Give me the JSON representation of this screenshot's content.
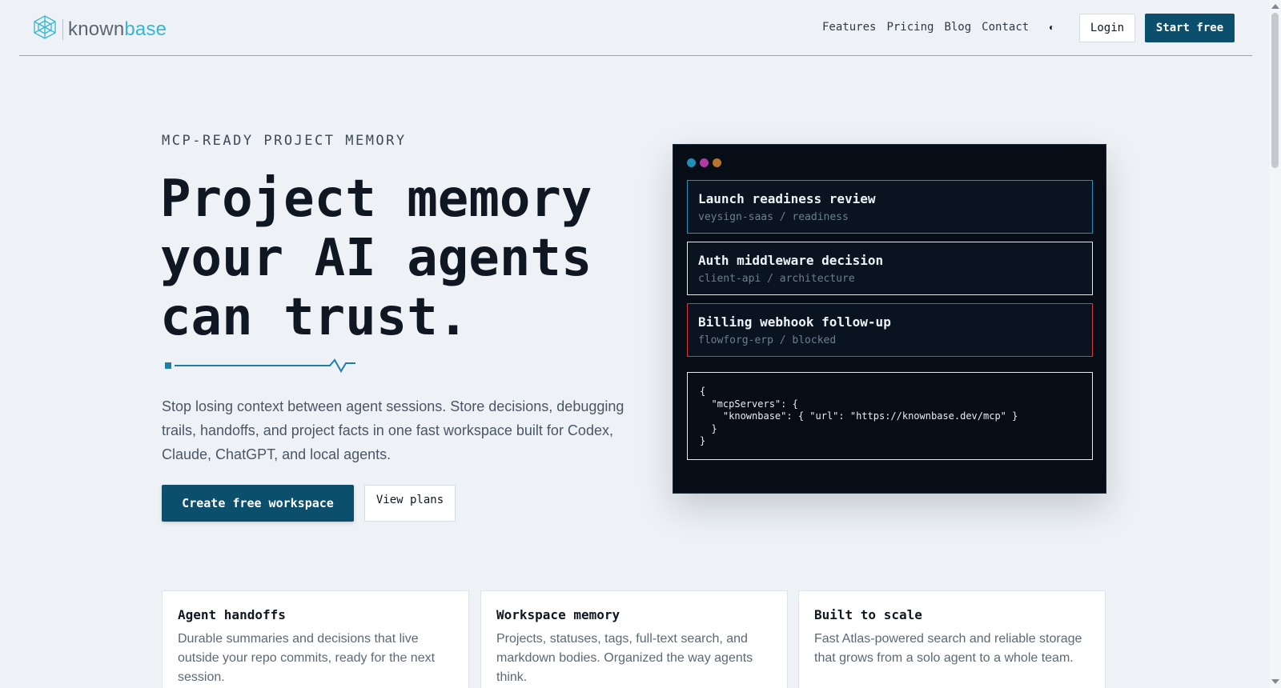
{
  "brand": {
    "name_part1": "known",
    "name_part2": "base",
    "accent": "#35b6d3"
  },
  "nav": {
    "items": [
      "Features",
      "Pricing",
      "Blog",
      "Contact"
    ],
    "theme_toggle_glyph": "◐",
    "login_label": "Login",
    "start_label": "Start free"
  },
  "hero": {
    "eyebrow": "MCP-READY PROJECT MEMORY",
    "headline_lines": [
      "Project memory",
      "your AI agents",
      "can trust."
    ],
    "lead": "Stop losing context between agent sessions. Store decisions, debugging trails, handoffs, and project facts in one fast workspace built for Codex, Claude, ChatGPT, and local agents.",
    "primary_cta": "Create free workspace",
    "secondary_cta": "View plans"
  },
  "panel": {
    "dots": [
      "#1f8fb5",
      "#b23aa3",
      "#b8742a"
    ],
    "cards": [
      {
        "title": "Launch readiness review",
        "subtitle": "veysign-saas / readiness",
        "border": "#2b8fb3"
      },
      {
        "title": "Auth middleware decision",
        "subtitle": "client-api / architecture",
        "border": "#e6ebf0"
      },
      {
        "title": "Billing webhook follow-up",
        "subtitle": "flowforg-erp / blocked",
        "border": "#d8363c"
      }
    ],
    "code": "{\n  \"mcpServers\": {\n    \"knownbase\": { \"url\": \"https://knownbase.dev/mcp\" }\n  }\n}"
  },
  "features": [
    {
      "title": "Agent handoffs",
      "body": "Durable summaries and decisions that live outside your repo commits, ready for the next session."
    },
    {
      "title": "Workspace memory",
      "body": "Projects, statuses, tags, full-text search, and markdown bodies. Organized the way agents think."
    },
    {
      "title": "Built to scale",
      "body": "Fast Atlas-powered search and reliable storage that grows from a solo agent to a whole team."
    }
  ],
  "colors": {
    "primary": "#0b4f6c",
    "background": "#eef2f6",
    "panel_bg": "#060d17"
  }
}
